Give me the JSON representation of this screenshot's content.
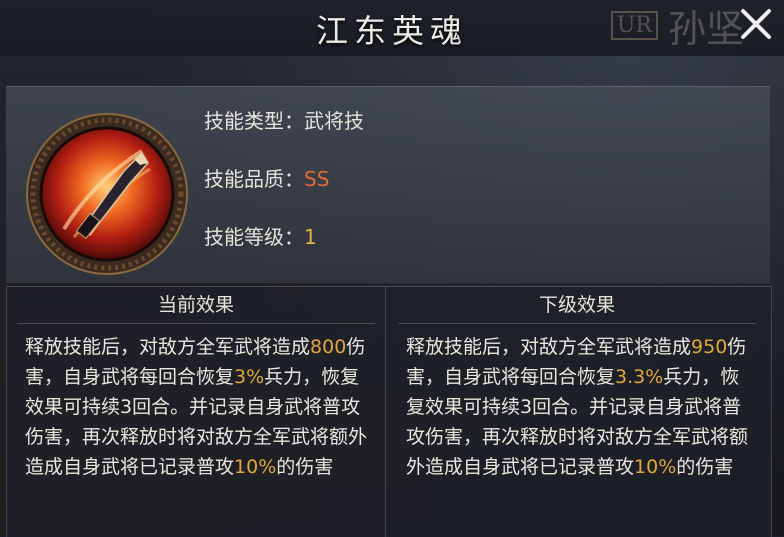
{
  "title": "江东英魂",
  "hero": {
    "rarity": "UR",
    "name": "孙坚"
  },
  "skill": {
    "type_label": "技能类型：",
    "type_value": "武将技",
    "quality_label": "技能品质：",
    "quality_value": "SS",
    "level_label": "技能等级：",
    "level_value": "1",
    "icon": "flaming-spear-icon"
  },
  "current": {
    "header": "当前效果",
    "seg": [
      "释放技能后，对敌方全军武将造成",
      "800",
      "伤害，自身武将每回合恢复",
      "3%",
      "兵力，恢复效果可持续3回合。并记录自身武将普攻伤害，再次释放时将对敌方全军武将额外造成自身武将已记录普攻",
      "10%",
      "的伤害"
    ]
  },
  "next": {
    "header": "下级效果",
    "seg": [
      "释放技能后，对敌方全军武将造成",
      "950",
      "伤害，自身武将每回合恢复",
      "3.3%",
      "兵力，恢复效果可持续3回合。并记录自身武将普攻伤害，再次释放时将对敌方全军武将额外造成自身武将已记录普攻",
      "10%",
      "的伤害"
    ]
  },
  "colors": {
    "highlight": "#e0a83a",
    "quality": "#e56a3a",
    "level": "#e0b24a"
  }
}
